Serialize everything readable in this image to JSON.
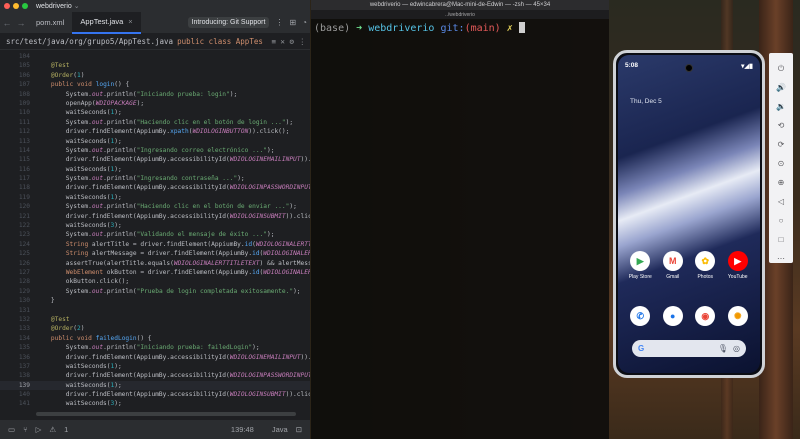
{
  "ide": {
    "window_title": "webdriverio",
    "tabs": [
      {
        "label": "pom.xml",
        "active": false
      },
      {
        "label": "AppTest.java",
        "active": true
      }
    ],
    "notice": "Introducing: Git Support",
    "breadcrumb": "src/test/java/org/grupo5/AppTest.java",
    "breadcrumb_class": "public class AppTes",
    "lines": [
      {
        "n": "104",
        "html": ""
      },
      {
        "n": "105",
        "html": "    <span class='an'>@Test</span>"
      },
      {
        "n": "106",
        "html": "    <span class='an'>@Order</span>(<span class='nm'>1</span>)"
      },
      {
        "n": "107",
        "html": "    <span class='kw'>public void</span> <span class='fn'>login</span>() {"
      },
      {
        "n": "108",
        "html": "        System.<span class='sf'>out</span>.println(<span class='st'>\"Iniciando prueba: login\"</span>);"
      },
      {
        "n": "109",
        "html": "        openApp(<span class='sf'>WDIOPACKAGE</span>);"
      },
      {
        "n": "110",
        "html": "        waitSeconds(<span class='nm'>1</span>);"
      },
      {
        "n": "111",
        "html": "        System.<span class='sf'>out</span>.println(<span class='st'>\"Haciendo clic en el botón de login ...\"</span>);"
      },
      {
        "n": "112",
        "html": "        driver.findElement(AppiumBy.<span class='fn'>xpath</span>(<span class='sf'>WDIOLOGINBUTTON</span>)).click();"
      },
      {
        "n": "113",
        "html": "        waitSeconds(<span class='nm'>1</span>);"
      },
      {
        "n": "114",
        "html": "        System.<span class='sf'>out</span>.println(<span class='st'>\"Ingresando correo electrónico ...\"</span>);"
      },
      {
        "n": "115",
        "html": "        driver.findElement(AppiumBy.accessibilityId(<span class='sf'>WDIOLOGINEMAILINPUT</span>)).sendK"
      },
      {
        "n": "116",
        "html": "        waitSeconds(<span class='nm'>1</span>);"
      },
      {
        "n": "117",
        "html": "        System.<span class='sf'>out</span>.println(<span class='st'>\"Ingresando contraseña ...\"</span>);"
      },
      {
        "n": "118",
        "html": "        driver.findElement(AppiumBy.accessibilityId(<span class='sf'>WDIOLOGINPASSWORDINPUT</span>)).se"
      },
      {
        "n": "119",
        "html": "        waitSeconds(<span class='nm'>1</span>);"
      },
      {
        "n": "120",
        "html": "        System.<span class='sf'>out</span>.println(<span class='st'>\"Haciendo clic en el botón de enviar ...\"</span>);"
      },
      {
        "n": "121",
        "html": "        driver.findElement(AppiumBy.accessibilityId(<span class='sf'>WDIOLOGINSUBMIT</span>)).click();"
      },
      {
        "n": "122",
        "html": "        waitSeconds(<span class='nm'>3</span>);"
      },
      {
        "n": "123",
        "html": "        System.<span class='sf'>out</span>.println(<span class='st'>\"Validando el mensaje de éxito ...\"</span>);"
      },
      {
        "n": "124",
        "html": "        <span class='kw'>String</span> alertTitle = driver.findElement(AppiumBy.<span class='fn'>id</span>(<span class='sf'>WDIOLOGINALERTTITLE</span>"
      },
      {
        "n": "125",
        "html": "        <span class='kw'>String</span> alertMessage = driver.findElement(AppiumBy.<span class='fn'>id</span>(<span class='sf'>WDIOLOGINALERTMES</span>"
      },
      {
        "n": "126",
        "html": "        assertTrue(alertTitle.equals(<span class='sf'>WDIOLOGINALERTTITLETEXT</span>) &amp;&amp; alertMessage."
      },
      {
        "n": "127",
        "html": "        <span class='kw'>WebElement</span> okButton = driver.findElement(AppiumBy.<span class='fn'>id</span>(<span class='sf'>WDIOLOGINALERTOKB</span>"
      },
      {
        "n": "128",
        "html": "        okButton.click();"
      },
      {
        "n": "129",
        "html": "        System.<span class='sf'>out</span>.println(<span class='st'>\"Prueba de login completada exitosamente.\"</span>);"
      },
      {
        "n": "130",
        "html": "    }"
      },
      {
        "n": "131",
        "html": ""
      },
      {
        "n": "132",
        "html": "    <span class='an'>@Test</span>"
      },
      {
        "n": "133",
        "html": "    <span class='an'>@Order</span>(<span class='nm'>2</span>)"
      },
      {
        "n": "134",
        "html": "    <span class='kw'>public void</span> <span class='fn'>failedLogin</span>() {"
      },
      {
        "n": "135",
        "html": "        System.<span class='sf'>out</span>.println(<span class='st'>\"Iniciando prueba: failedLogin\"</span>);"
      },
      {
        "n": "136",
        "html": "        driver.findElement(AppiumBy.accessibilityId(<span class='sf'>WDIOLOGINEMAILINPUT</span>)).sendK"
      },
      {
        "n": "137",
        "html": "        waitSeconds(<span class='nm'>1</span>);"
      },
      {
        "n": "138",
        "html": "        driver.findElement(AppiumBy.accessibilityId(<span class='sf'>WDIOLOGINPASSWORDINPUT</span>)).se"
      },
      {
        "n": "139",
        "html": "        waitSeconds(<span class='nm'>1</span>);",
        "current": true
      },
      {
        "n": "140",
        "html": "        driver.findElement(AppiumBy.accessibilityId(<span class='sf'>WDIOLOGINSUBMIT</span>)).click();"
      },
      {
        "n": "141",
        "html": "        waitSeconds(<span class='nm'>3</span>);"
      }
    ],
    "status": {
      "problems": "1",
      "cursor_pos": "139:48",
      "language": "Java"
    }
  },
  "terminal": {
    "title": "webdriverio — edwincabrera@Mac-mini-de-Edwin — -zsh — 45×34",
    "tab": "../webdriverio",
    "prompt_env": "(base)",
    "prompt_dir": "webdriverio",
    "prompt_git": "git:",
    "prompt_branch": "(main)",
    "prompt_mark": "✗"
  },
  "phone": {
    "time": "5:08",
    "battery": "▾◢▮",
    "date": "Thu, Dec 5",
    "apps_row1": [
      {
        "label": "Play Store",
        "glyph": "▶",
        "bg": "#ffffff",
        "fg": "#34a853"
      },
      {
        "label": "Gmail",
        "glyph": "M",
        "bg": "#ffffff",
        "fg": "#ea4335"
      },
      {
        "label": "Photos",
        "glyph": "✿",
        "bg": "#ffffff",
        "fg": "#fbbc05"
      },
      {
        "label": "YouTube",
        "glyph": "▶",
        "bg": "#ff0000",
        "fg": "#ffffff"
      }
    ],
    "apps_row2": [
      {
        "label": "",
        "glyph": "✆",
        "bg": "#ffffff",
        "fg": "#1a73e8"
      },
      {
        "label": "",
        "glyph": "●",
        "bg": "#ffffff",
        "fg": "#1a73e8"
      },
      {
        "label": "",
        "glyph": "◉",
        "bg": "#ffffff",
        "fg": "#ea4335"
      },
      {
        "label": "",
        "glyph": "✺",
        "bg": "#ffffff",
        "fg": "#f29900"
      }
    ],
    "search_g": "G"
  },
  "emulator_toolbar": [
    {
      "name": "power-icon",
      "glyph": "⏻"
    },
    {
      "name": "volume-up-icon",
      "glyph": "🔊"
    },
    {
      "name": "volume-down-icon",
      "glyph": "🔉"
    },
    {
      "name": "rotate-left-icon",
      "glyph": "⟲"
    },
    {
      "name": "rotate-right-icon",
      "glyph": "⟳"
    },
    {
      "name": "camera-icon",
      "glyph": "⊙"
    },
    {
      "name": "zoom-icon",
      "glyph": "⊕"
    },
    {
      "name": "back-icon",
      "glyph": "◁"
    },
    {
      "name": "home-icon",
      "glyph": "○"
    },
    {
      "name": "overview-icon",
      "glyph": "□"
    },
    {
      "name": "more-icon",
      "glyph": "⋯"
    }
  ]
}
